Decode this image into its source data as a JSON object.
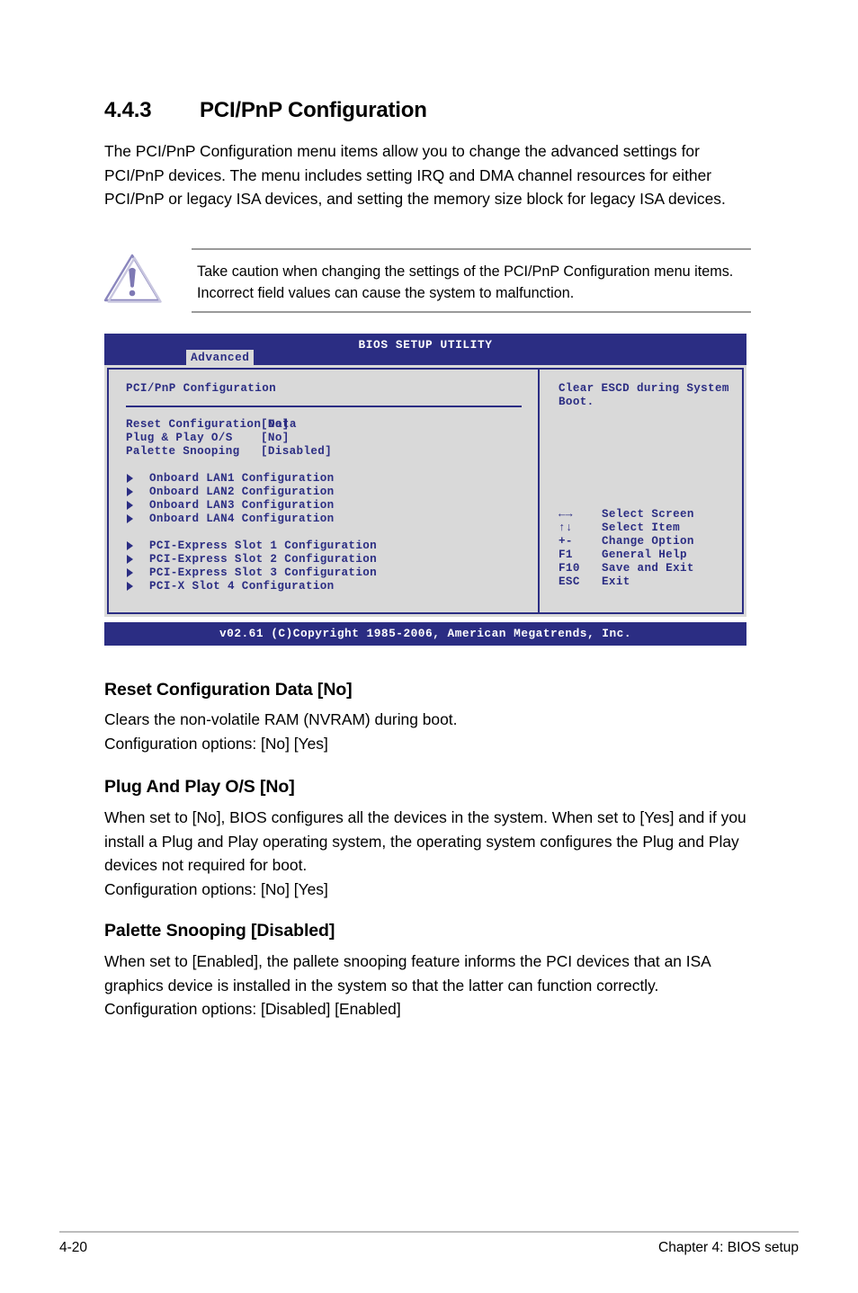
{
  "section": {
    "number": "4.4.3",
    "title": "PCI/PnP Configuration",
    "intro": "The PCI/PnP Configuration menu items allow you to change the advanced settings for PCI/PnP devices. The menu includes setting IRQ and DMA channel resources for either PCI/PnP or legacy ISA devices, and setting the memory size block for legacy ISA devices."
  },
  "caution": {
    "icon": "warning-triangle-icon",
    "text": "Take caution when changing the settings of the PCI/PnP Configuration menu items. Incorrect field values can cause the system to malfunction.",
    "icon_color": "#8a86bd"
  },
  "bios": {
    "title": "BIOS SETUP UTILITY",
    "active_tab": "Advanced",
    "panel_title": "PCI/PnP Configuration",
    "header_bg": "#2b2d83",
    "body_bg": "#d9d9d9",
    "text_color": "#2b2d83",
    "options": [
      {
        "label": "Reset Configuration Data",
        "value": "[No]"
      },
      {
        "label": "Plug & Play O/S",
        "value": "[No]"
      },
      {
        "label": "Palette Snooping",
        "value": "[Disabled]"
      }
    ],
    "submenus_group1": [
      "Onboard LAN1 Configuration",
      "Onboard LAN2 Configuration",
      "Onboard LAN3 Configuration",
      "Onboard LAN4 Configuration"
    ],
    "submenus_group2": [
      "PCI-Express Slot 1 Configuration",
      "PCI-Express Slot 2 Configuration",
      "PCI-Express Slot 3 Configuration",
      "PCI-X Slot 4 Configuration"
    ],
    "help_text": "Clear ESCD during System Boot.",
    "keys": [
      {
        "key": "←→",
        "desc": "Select Screen"
      },
      {
        "key": "↑↓",
        "desc": "Select Item"
      },
      {
        "key": "+-",
        "desc": "Change Option"
      },
      {
        "key": "F1",
        "desc": "General Help"
      },
      {
        "key": "F10",
        "desc": "Save and Exit"
      },
      {
        "key": "ESC",
        "desc": "Exit"
      }
    ],
    "footer": "v02.61 (C)Copyright 1985-2006, American Megatrends, Inc."
  },
  "descriptions": [
    {
      "heading": "Reset Configuration Data [No]",
      "body": "Clears the non-volatile RAM (NVRAM) during boot.\nConfiguration options: [No] [Yes]"
    },
    {
      "heading": "Plug And Play O/S [No]",
      "body": "When set to [No], BIOS configures all the devices in the system. When set to [Yes] and if you install a Plug and Play operating system, the operating system configures the Plug and Play devices not required for boot.\nConfiguration options: [No] [Yes]"
    },
    {
      "heading": "Palette Snooping [Disabled]",
      "body": "When set to [Enabled], the pallete snooping feature informs the PCI devices that an ISA graphics device is installed in the system so that the latter can function correctly. Configuration options: [Disabled] [Enabled]"
    }
  ],
  "page_footer": {
    "page_number": "4-20",
    "chapter": "Chapter 4: BIOS setup"
  }
}
